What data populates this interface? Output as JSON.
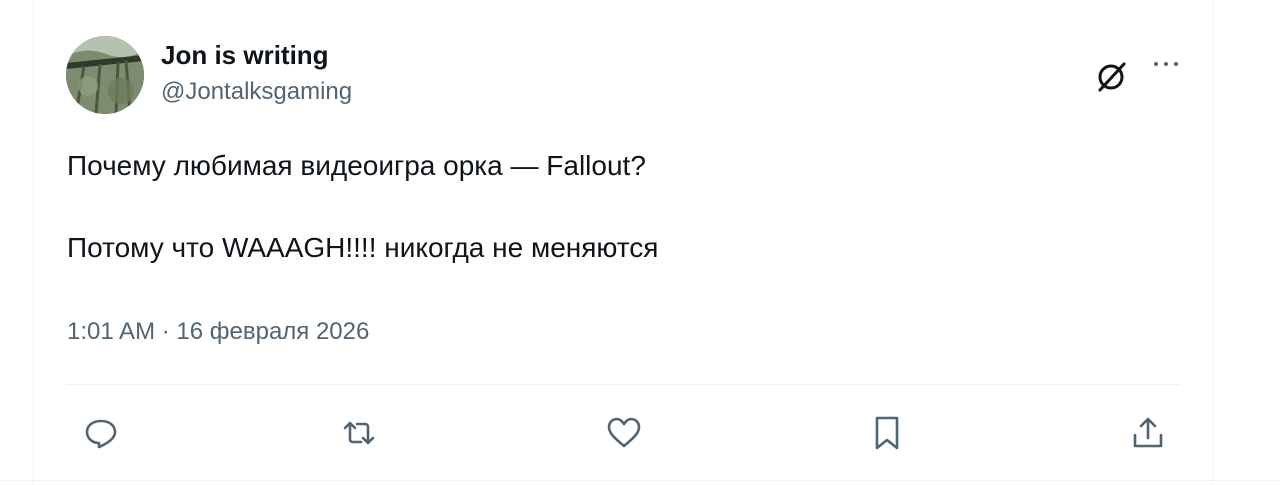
{
  "author": {
    "name": "Jon is writing",
    "handle": "@Jontalksgaming"
  },
  "tweet": {
    "line1": "Почему любимая видеоигра орка — Fallout?",
    "line2": "Потому что WAAAGH!!!! никогда не меняются"
  },
  "meta": {
    "timestamp": "1:01 AM · 16 февраля 2026"
  },
  "icons": {
    "top_right": [
      "grok-icon",
      "more-icon"
    ],
    "actions": [
      "reply-icon",
      "retweet-icon",
      "like-icon",
      "bookmark-icon",
      "share-icon"
    ]
  },
  "colors": {
    "text": "#0f1419",
    "secondary": "#536471",
    "divider": "#eff3f4"
  }
}
